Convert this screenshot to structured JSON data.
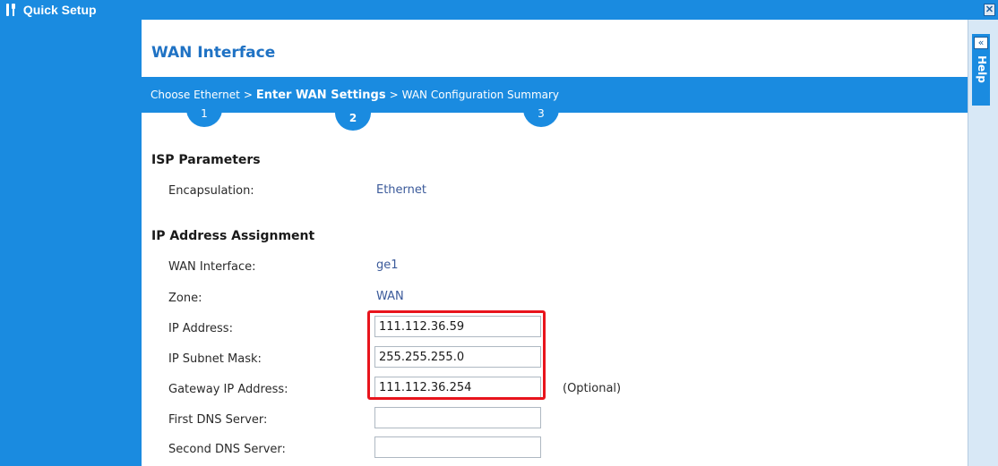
{
  "window": {
    "title": "Quick Setup",
    "close_symbol": "✕"
  },
  "page": {
    "title": "WAN Interface"
  },
  "steps": [
    {
      "label": "Choose Ethernet",
      "number": "1"
    },
    {
      "label": "Enter WAN Settings",
      "number": "2"
    },
    {
      "label": "WAN Configuration Summary",
      "number": "3"
    }
  ],
  "step_separator": ">",
  "isp": {
    "heading": "ISP Parameters",
    "encapsulation_label": "Encapsulation:",
    "encapsulation_value": "Ethernet"
  },
  "ip": {
    "heading": "IP Address Assignment",
    "wan_interface_label": "WAN Interface:",
    "wan_interface_value": "ge1",
    "zone_label": "Zone:",
    "zone_value": "WAN",
    "ip_address_label": "IP Address:",
    "ip_address_value": "111.112.36.59",
    "subnet_label": "IP Subnet Mask:",
    "subnet_value": "255.255.255.0",
    "gateway_label": "Gateway IP Address:",
    "gateway_value": "111.112.36.254",
    "optional": "(Optional)",
    "dns1_label": "First DNS Server:",
    "dns1_value": "",
    "dns2_label": "Second DNS Server:",
    "dns2_value": ""
  },
  "help": {
    "label": "Help",
    "collapse_symbol": "«"
  },
  "colors": {
    "accent": "#1a8be0",
    "highlight": "#e8141c",
    "title": "#1f72c4"
  }
}
